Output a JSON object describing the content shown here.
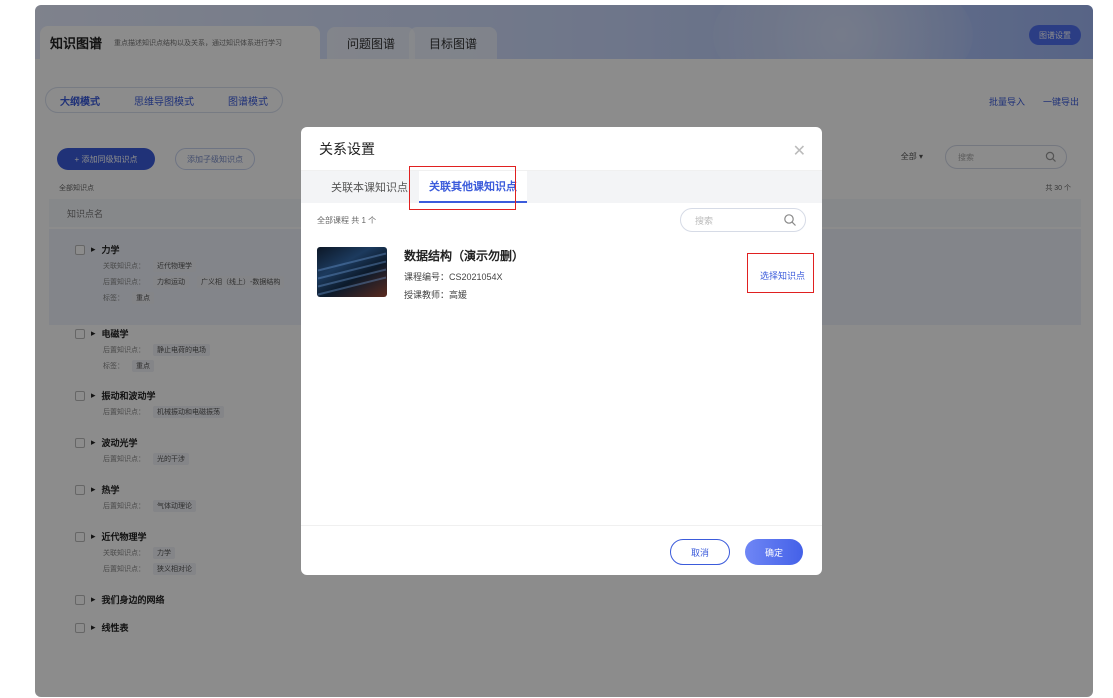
{
  "header": {
    "tab_main": "知识图谱",
    "tab_main_desc": "重点描述知识点结构以及关系，通过知识体系进行学习",
    "tab_problem": "问题图谱",
    "tab_goal": "目标图谱",
    "corner_button": "图谱设置"
  },
  "modes": [
    "大纲模式",
    "思维导图模式",
    "图谱模式"
  ],
  "actions": {
    "import": "批量导入",
    "export": "一键导出"
  },
  "toolbar": {
    "add_same": "+ 添加同级知识点",
    "add_child": "添加子级知识点",
    "filter": "全部 ▾",
    "search_placeholder": "搜索",
    "all_label": "全部知识点",
    "total": "共 30 个"
  },
  "tree": {
    "header": "知识点名",
    "nodes": [
      {
        "title": "力学",
        "line1_label": "关联知识点：",
        "line1_tags": [
          "近代物理学"
        ],
        "line2_label": "后置知识点：",
        "line2_tags": [
          "力和运动",
          "广义相（线上）-数据结构"
        ],
        "line3_label": "标签：",
        "line3_tags": [
          "重点"
        ]
      },
      {
        "title": "电磁学",
        "line1_label": "后置知识点：",
        "line1_tags": [
          "静止电荷的电场"
        ],
        "line2_label": "标签：",
        "line2_tags": [
          "重点"
        ]
      },
      {
        "title": "振动和波动学",
        "line1_label": "后置知识点：",
        "line1_tags": [
          "机械振动和电磁振荡"
        ]
      },
      {
        "title": "波动光学",
        "line1_label": "后置知识点：",
        "line1_tags": [
          "光的干涉"
        ]
      },
      {
        "title": "热学",
        "line1_label": "后置知识点：",
        "line1_tags": [
          "气体动理论"
        ]
      },
      {
        "title": "近代物理学",
        "line1_label": "关联知识点：",
        "line1_tags": [
          "力学"
        ],
        "line2_label": "后置知识点：",
        "line2_tags": [
          "狭义相对论"
        ]
      },
      {
        "title": "我们身边的网络"
      },
      {
        "title": "线性表"
      }
    ]
  },
  "modal": {
    "title": "关系设置",
    "close": "✕",
    "tab_current": "关联本课知识点",
    "tab_other": "关联其他课知识点",
    "course_count": "全部课程 共 1 个",
    "search_placeholder": "搜索",
    "course": {
      "name": "数据结构（演示勿删）",
      "code": "课程编号：CS2021054X",
      "teacher": "授课教师：高媛"
    },
    "select_link": "选择知识点",
    "cancel": "取消",
    "confirm": "确定"
  }
}
